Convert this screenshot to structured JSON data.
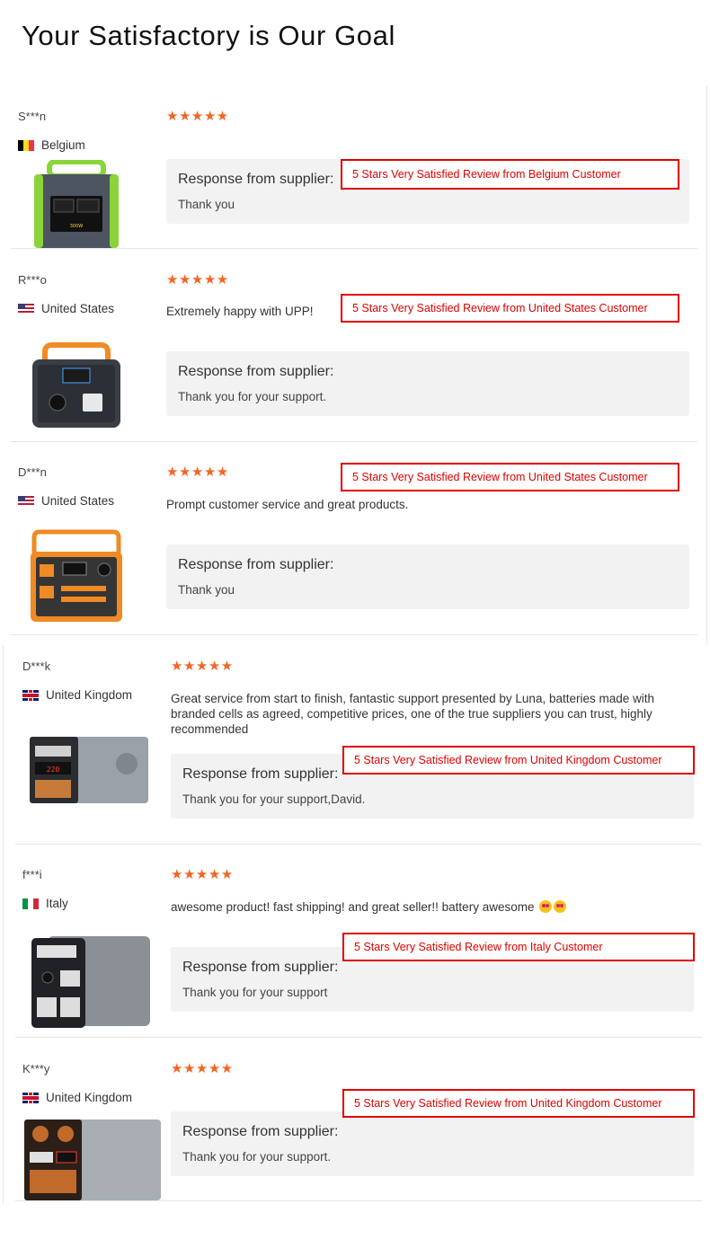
{
  "page": {
    "title": "Your Satisfactory is Our Goal"
  },
  "common": {
    "stars": "★★★★★",
    "response_title": "Response from supplier:"
  },
  "reviews": [
    {
      "name": "S***n",
      "country": "Belgium",
      "flag": "belgium-flag-icon",
      "text": "",
      "response": "Thank you",
      "badge": "5 Stars Very Satisfied Review from Belgium Customer",
      "product": "green-portable-power-station-image"
    },
    {
      "name": "R***o",
      "country": "United States",
      "flag": "usa-flag-icon",
      "text": "Extremely happy with UPP!",
      "response": "Thank you for your support.",
      "badge": "5 Stars Very Satisfied Review from United States Customer",
      "product": "orange-handle-power-station-image"
    },
    {
      "name": "D***n",
      "country": "United States",
      "flag": "usa-flag-icon",
      "text": "Prompt customer service and great products.",
      "response": "Thank you",
      "badge": "5 Stars Very Satisfied Review from United States Customer",
      "product": "orange-power-station-image"
    },
    {
      "name": "D***k",
      "country": "United Kingdom",
      "flag": "uk-flag-icon",
      "text": "Great service from start to finish, fantastic support presented by Luna, batteries made with branded cells as agreed, competitive prices, one of the true suppliers you can trust, highly recommended",
      "response": "Thank you for your support,David.",
      "badge": "5 Stars Very Satisfied Review from United Kingdom Customer",
      "product": "silver-power-station-image"
    },
    {
      "name": "f***i",
      "country": "Italy",
      "flag": "italy-flag-icon",
      "text": "awesome product! fast shipping! and great seller!! battery awesome",
      "response": "Thank you for your support",
      "badge": "5 Stars Very Satisfied Review from Italy Customer",
      "product": "dark-silver-power-station-image"
    },
    {
      "name": "K***y",
      "country": "United Kingdom",
      "flag": "uk-flag-icon",
      "text": "",
      "response": "Thank you for your support.",
      "badge": "5 Stars Very Satisfied Review from United Kingdom Customer",
      "product": "large-silver-power-station-image"
    }
  ],
  "colors": {
    "accent": "#f26522",
    "badge_red": "#e10000",
    "box_bg": "#f2f2f2"
  }
}
